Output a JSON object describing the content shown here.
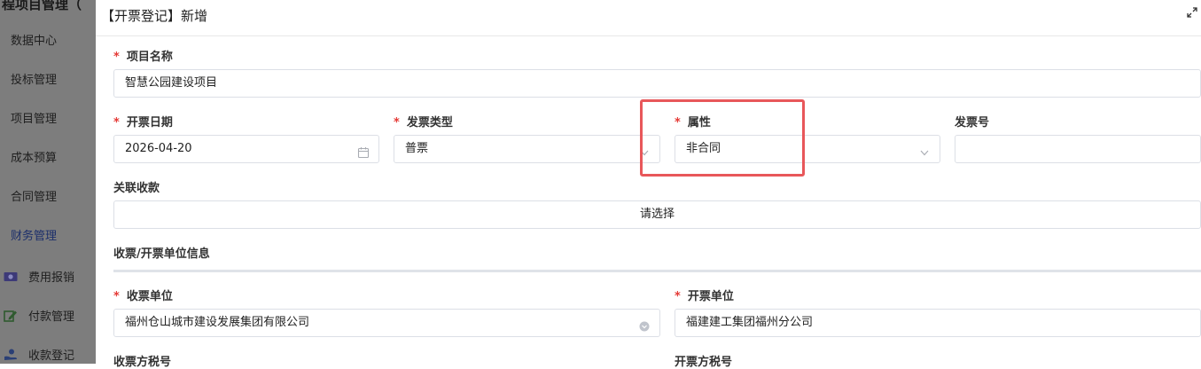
{
  "sidebar": {
    "app_title": "程项目管理（",
    "items": [
      {
        "label": "数据中心"
      },
      {
        "label": "投标管理"
      },
      {
        "label": "项目管理"
      },
      {
        "label": "成本预算"
      },
      {
        "label": "合同管理"
      },
      {
        "label": "财务管理"
      }
    ],
    "sub_items": [
      {
        "label": "费用报销",
        "icon": "money-icon"
      },
      {
        "label": "付款管理",
        "icon": "edit-icon"
      },
      {
        "label": "收款登记",
        "icon": "receive-hand-icon"
      }
    ]
  },
  "modal": {
    "title": "【开票登记】新增",
    "fields": {
      "project_name": {
        "label": "项目名称",
        "value": "智慧公园建设项目"
      },
      "invoice_date": {
        "label": "开票日期",
        "value": "2026-04-20"
      },
      "invoice_type": {
        "label": "发票类型",
        "value": "普票"
      },
      "attribute": {
        "label": "属性",
        "value": "非合同"
      },
      "invoice_no": {
        "label": "发票号",
        "value": ""
      },
      "related_receipt": {
        "label": "关联收款",
        "value": "请选择"
      },
      "receiving_unit": {
        "label": "收票单位",
        "value": "福州仓山城市建设发展集团有限公司"
      },
      "issuing_unit": {
        "label": "开票单位",
        "value": "福建建工集团福州分公司"
      },
      "receiver_tax_no": {
        "label": "收票方税号"
      },
      "issuer_tax_no": {
        "label": "开票方税号"
      }
    },
    "section_title": "收票/开票单位信息"
  },
  "colors": {
    "required": "#e53935",
    "highlight": "#e8575a",
    "sidebar_mask": "#7d7d7d",
    "active_nav": "#1c2f6b"
  }
}
